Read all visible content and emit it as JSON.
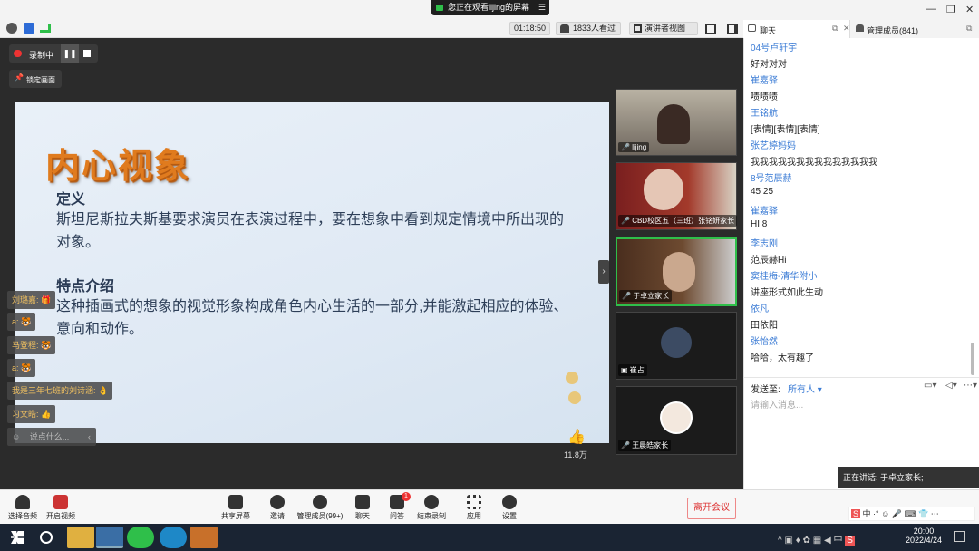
{
  "top": {
    "share_banner": "您正在观看lijing的屏幕",
    "timer": "01:18:50",
    "viewers": "1833人看过",
    "view_mode": "演讲者视图"
  },
  "chat_tabs": {
    "chat": "聊天",
    "members": "管理成员(841)"
  },
  "recording": {
    "label": "录制中",
    "lock_label": "锁定画面"
  },
  "slide": {
    "title": "内心视象",
    "section1_heading": "定义",
    "section1_body": "斯坦尼斯拉夫斯基要求演员在表演过程中，要在想象中看到规定情境中所出现的对象。",
    "section2_heading": "特点介绍",
    "section2_body": "这种插画式的想象的视觉形象构成角色内心生活的一部分,并能激起相应的体验、意向和动作。"
  },
  "like_count": "11.8万",
  "videos": [
    {
      "name": "lijing"
    },
    {
      "name": "CBD校区五（三班）张铭妍家长"
    },
    {
      "name": "于卓立家长"
    },
    {
      "name": "崔占"
    },
    {
      "name": "王晨皓家长"
    }
  ],
  "comments": [
    {
      "text": "刘璐嘉:"
    },
    {
      "text": "a:"
    },
    {
      "text": "马登程:"
    },
    {
      "text": "a:"
    },
    {
      "text": "我是三年七班的刘诗涵:"
    },
    {
      "text": "习文皓:"
    }
  ],
  "comment_input_placeholder": "说点什么...",
  "chat": [
    {
      "name": "04号卢轩宇",
      "msg": "好对对对"
    },
    {
      "name": "崔嘉驿",
      "msg": "啧啧啧"
    },
    {
      "name": "王铭航",
      "msg": "[表情][表情][表情]"
    },
    {
      "name": "张艺婷妈妈",
      "msg": "我我我我我我我我我我我我我我"
    },
    {
      "name": "8号范辰赫",
      "msg": "45     25"
    },
    {
      "name": "崔嘉驿",
      "msg": "HI     8"
    },
    {
      "name": "李志刚",
      "msg": "范辰赫Hi"
    },
    {
      "name": "窦桂梅-清华附小",
      "msg": "讲座形式如此生动"
    },
    {
      "name": "依凡",
      "msg": "田依阳"
    },
    {
      "name": "张怡然",
      "msg": "哈哈，太有趣了"
    }
  ],
  "send_to": {
    "label": "发送至:",
    "target": "所有人"
  },
  "chat_input_placeholder": "请输入消息...",
  "speaking": "正在讲话: 于卓立家长;",
  "toolbar": {
    "audio": "选择音频",
    "video": "开启视频",
    "share": "共享屏幕",
    "invite": "邀请",
    "members": "管理成员(99+)",
    "chat": "聊天",
    "qa": "问答",
    "qa_badge": "1",
    "end_record": "结束录制",
    "apps": "应用",
    "settings": "设置",
    "leave": "离开会议"
  },
  "taskbar": {
    "time": "20:00",
    "date": "2022/4/24",
    "ime": "中"
  }
}
